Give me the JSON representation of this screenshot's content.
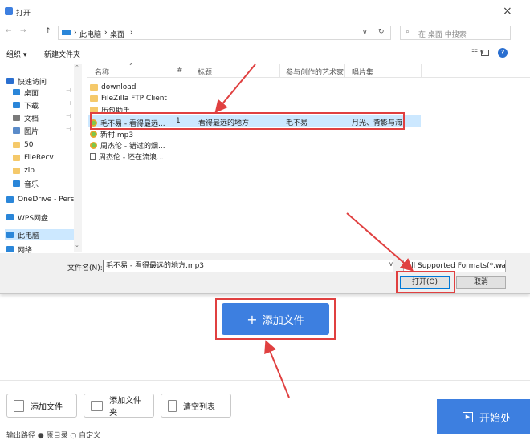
{
  "dialog": {
    "title": "打开",
    "close": "×",
    "nav": {
      "back": "←",
      "forward": "→",
      "up": "↑",
      "refresh": "↻",
      "dropdown": "∨"
    },
    "breadcrumb": [
      "此电脑",
      "桌面"
    ],
    "search_placeholder": "在 桌面 中搜索",
    "toolbar": {
      "organize": "组织 ▾",
      "new_folder": "新建文件夹"
    },
    "sidebar": [
      {
        "label": "快速访问",
        "icon": "star-icon"
      },
      {
        "label": "桌面",
        "icon": "desktop-icon"
      },
      {
        "label": "下载",
        "icon": "download-icon"
      },
      {
        "label": "文档",
        "icon": "document-icon"
      },
      {
        "label": "图片",
        "icon": "picture-icon"
      },
      {
        "label": "50",
        "icon": "folder-icon"
      },
      {
        "label": "FileRecv",
        "icon": "folder-icon"
      },
      {
        "label": "zip",
        "icon": "folder-icon"
      },
      {
        "label": "音乐",
        "icon": "music-icon"
      },
      {
        "label": "OneDrive - Perso",
        "icon": "cloud-icon"
      },
      {
        "label": "WPS网盘",
        "icon": "cloud-icon"
      },
      {
        "label": "此电脑",
        "icon": "computer-icon"
      },
      {
        "label": "网络",
        "icon": "network-icon"
      }
    ],
    "columns": {
      "name": "名称",
      "number": "#",
      "title": "标题",
      "artist": "参与创作的艺术家",
      "album": "唱片集"
    },
    "files": [
      {
        "name": "download",
        "type": "folder"
      },
      {
        "name": "FileZilla FTP Client",
        "type": "folder"
      },
      {
        "name": "历包助手",
        "type": "folder"
      },
      {
        "name": "毛不易 - 看得最远...",
        "type": "mp3",
        "number": "1",
        "title": "看得最远的地方",
        "artist": "毛不易",
        "album": "月光、背影与海"
      },
      {
        "name": "新村.mp3",
        "type": "mp3"
      },
      {
        "name": "周杰伦 - 错过的烟...",
        "type": "mp3"
      },
      {
        "name": "周杰伦 - 还在流浪...",
        "type": "doc"
      }
    ],
    "filename_label": "文件名(N):",
    "filename_value": "毛不易 - 看得最远的地方.mp3",
    "filter_value": "All Supported Formats(*.wav",
    "open_button": "打开(O)",
    "cancel_button": "取消"
  },
  "app": {
    "add_file_big": "添加文件",
    "add_file": "添加文件",
    "add_folder": "添加文件夹",
    "clear_list": "清空列表",
    "start": "开始处",
    "bottom_partial": "输出路径    ● 原目录    ○ 自定义"
  },
  "colors": {
    "accent": "#3d7fe0",
    "highlight": "#cce8ff",
    "annotation": "#e04040"
  }
}
